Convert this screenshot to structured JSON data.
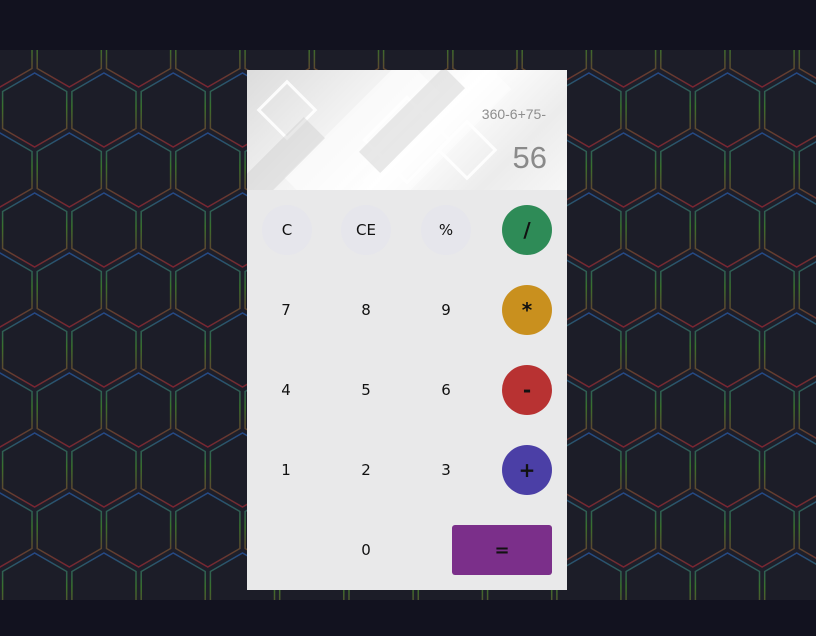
{
  "display": {
    "expression": "360-6+75-",
    "result": "56"
  },
  "keys": {
    "clear": "C",
    "clear_entry": "CE",
    "percent": "%",
    "divide": "/",
    "seven": "7",
    "eight": "8",
    "nine": "9",
    "multiply": "*",
    "four": "4",
    "five": "5",
    "six": "6",
    "subtract": "-",
    "one": "1",
    "two": "2",
    "three": "3",
    "add": "+",
    "zero": "0",
    "equals": "="
  },
  "colors": {
    "divide": "#2e8b57",
    "multiply": "#c9901e",
    "subtract": "#b83232",
    "add": "#4b3fa6",
    "equals": "#7b2f8a",
    "keypad_bg": "#e9e9ea",
    "page_bg": "#12121f"
  }
}
